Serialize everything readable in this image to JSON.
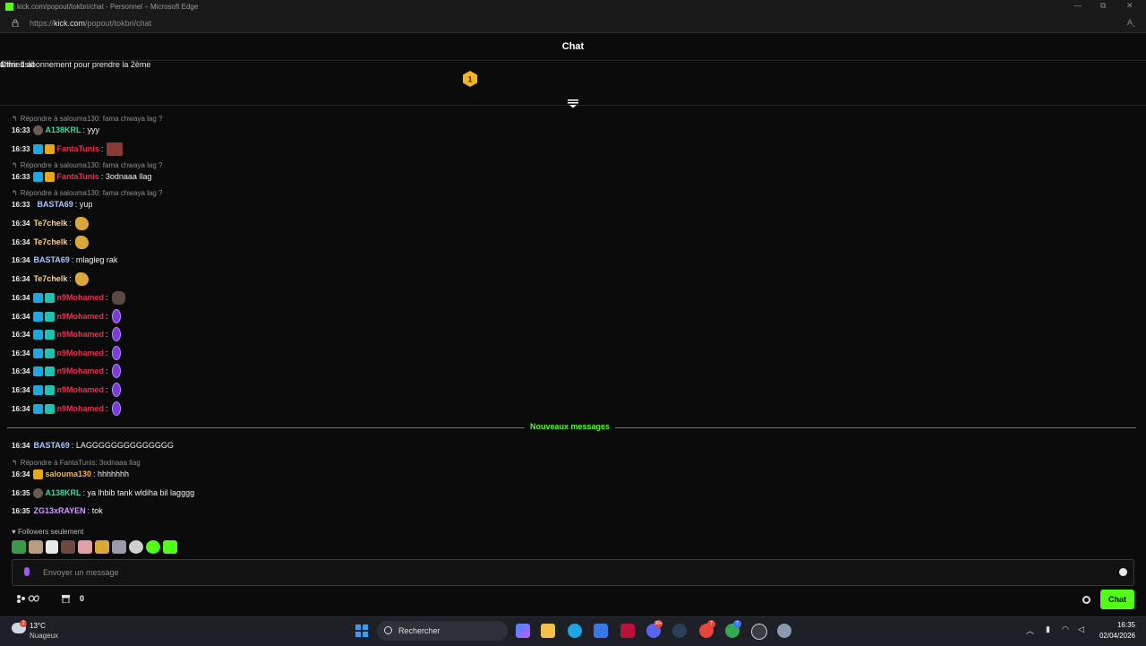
{
  "browser": {
    "window_title": "kick.com/popout/tokbri/chat - Personnel – Microsoft Edge",
    "url_prefix": "https://",
    "url_domain": "kick.com",
    "url_path": "/popout/tokbri/chat",
    "read_aloud": "Aˬ",
    "window_controls": [
      "—",
      "⧉",
      "✕"
    ]
  },
  "chat": {
    "title": "Chat",
    "pinned": {
      "rank": "1",
      "username": "ahmedskl",
      "gift_count": "1",
      "offer_text": "Offrir 1 abonnement pour prendre la 2ème"
    },
    "messages": [
      {
        "time": "16:33",
        "user": "A138KRL",
        "text": "yyy"
      },
      {
        "time": "16:33",
        "user": "FantaTunis",
        "text": ""
      },
      {
        "time": "16:33",
        "user": "FantaTunis",
        "text": "3odnaaa llag"
      },
      {
        "time": "16:33",
        "user": "BASTA69",
        "text": "yup"
      },
      {
        "time": "16:34",
        "user": "Te7chelk",
        "text": ""
      },
      {
        "time": "16:34",
        "user": "Te7chelk",
        "text": ""
      },
      {
        "time": "16:34",
        "user": "BASTA69",
        "text": "mlagleg rak"
      },
      {
        "time": "16:34",
        "user": "Te7chelk",
        "text": ""
      },
      {
        "time": "16:34",
        "user": "n9Mohamed",
        "text": ""
      },
      {
        "time": "16:34",
        "user": "n9Mohamed",
        "text": ""
      },
      {
        "time": "16:34",
        "user": "n9Mohamed",
        "text": ""
      },
      {
        "time": "16:34",
        "user": "n9Mohamed",
        "text": ""
      },
      {
        "time": "16:34",
        "user": "n9Mohamed",
        "text": ""
      },
      {
        "time": "16:34",
        "user": "n9Mohamed",
        "text": ""
      },
      {
        "time": "16:34",
        "user": "n9Mohamed",
        "text": ""
      },
      {
        "time": "16:34",
        "user": "BASTA69",
        "text": "LAGGGGGGGGGGGGGG"
      },
      {
        "time": "16:34",
        "user": "salouma130",
        "text": "hhhhhhh"
      },
      {
        "time": "16:35",
        "user": "A138KRL",
        "text": "ya lhbib tank wldiha bil lagggg"
      },
      {
        "time": "16:35",
        "user": "ZG13xRAYEN",
        "text": "tok"
      }
    ],
    "replies": [
      "Répondre à salouma130: fama chwaya lag ?",
      "Répondre à salouma130: fama chwaya lag ?",
      "Répondre à salouma130: fama chwaya lag ?",
      "Répondre à FantaTunis: 3odnaaa llag"
    ],
    "new_messages_label": "Nouveaux messages",
    "followers_only": "Followers seulement",
    "input_placeholder": "Envoyer un message",
    "points": "0",
    "send_label": "Chat",
    "colors": {
      "accent": "#53fc18",
      "A138KRL": "#3fd99a",
      "FantaTunis": "#e0334f",
      "BASTA69": "#a9c6ff",
      "Te7chelk": "#ffcf8a",
      "n9Mohamed": "#e0334f",
      "salouma130": "#ffb13b",
      "ZG13xRAYEN": "#d29bff"
    }
  },
  "taskbar": {
    "temperature": "13°C",
    "condition": "Nuageux",
    "weather_badge": "2",
    "search_label": "Rechercher",
    "time": "16:35",
    "date": "02/04/2026",
    "badges": [
      "99+",
      "7",
      "7"
    ]
  }
}
